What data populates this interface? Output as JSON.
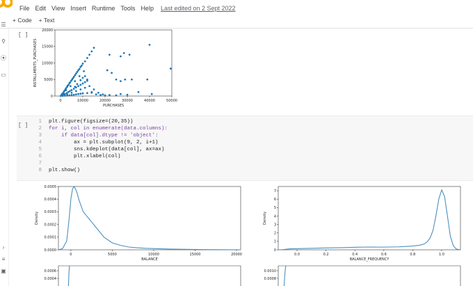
{
  "menu": {
    "items": [
      "File",
      "Edit",
      "View",
      "Insert",
      "Runtime",
      "Tools",
      "Help"
    ],
    "last_edited": "Last edited on 2 Sept 2022"
  },
  "toolbar": {
    "add_code": "+ Code",
    "add_text": "+ Text"
  },
  "cells": {
    "cell1": {
      "run_bracket": "[ ]"
    },
    "cell2": {
      "run_bracket": "[ ]",
      "code_lines": [
        {
          "n": "1",
          "t": "plt.figure(figsize=(20,35))"
        },
        {
          "n": "2",
          "t": "for i, col in enumerate(data.columns):"
        },
        {
          "n": "3",
          "t": "if data[col].dtype != 'object':"
        },
        {
          "n": "4",
          "t": "ax = plt.subplot(9, 2, i+1)"
        },
        {
          "n": "5",
          "t": "sns.kdeplot(data[col], ax=ax)"
        },
        {
          "n": "6",
          "t": "plt.xlabel(col)"
        },
        {
          "n": "7",
          "t": ""
        },
        {
          "n": "8",
          "t": "plt.show()"
        }
      ]
    }
  },
  "chart_data": [
    {
      "type": "scatter",
      "xlabel": "PURCHASES",
      "ylabel": "INSTALLMENTS_PURCHASES",
      "xlim": [
        -2500,
        50000
      ],
      "ylim": [
        0,
        20000
      ],
      "xticks": [
        "0",
        "10000",
        "20000",
        "30000",
        "40000",
        "50000"
      ],
      "yticks": [
        "0",
        "5000",
        "10000",
        "15000",
        "20000"
      ],
      "color": "#1f77b4",
      "points": [
        [
          200,
          100
        ],
        [
          500,
          400
        ],
        [
          800,
          700
        ],
        [
          1200,
          900
        ],
        [
          1500,
          1300
        ],
        [
          1800,
          1600
        ],
        [
          2200,
          2000
        ],
        [
          2500,
          2400
        ],
        [
          3000,
          2800
        ],
        [
          3200,
          3100
        ],
        [
          3600,
          3400
        ],
        [
          4000,
          3900
        ],
        [
          4300,
          4100
        ],
        [
          4800,
          4600
        ],
        [
          5200,
          5000
        ],
        [
          5600,
          5400
        ],
        [
          6000,
          5800
        ],
        [
          6500,
          6300
        ],
        [
          7000,
          6800
        ],
        [
          7500,
          7300
        ],
        [
          8000,
          7800
        ],
        [
          8500,
          8200
        ],
        [
          9000,
          8800
        ],
        [
          9500,
          9200
        ],
        [
          10000,
          9800
        ],
        [
          11000,
          10500
        ],
        [
          12000,
          11500
        ],
        [
          13000,
          12500
        ],
        [
          14000,
          13500
        ],
        [
          15000,
          14600
        ],
        [
          600,
          200
        ],
        [
          1000,
          300
        ],
        [
          1400,
          500
        ],
        [
          2000,
          600
        ],
        [
          2800,
          900
        ],
        [
          3500,
          1200
        ],
        [
          4200,
          1500
        ],
        [
          5000,
          1800
        ],
        [
          6000,
          2200
        ],
        [
          7000,
          2600
        ],
        [
          8000,
          3000
        ],
        [
          9000,
          3400
        ],
        [
          10000,
          3800
        ],
        [
          11000,
          4200
        ],
        [
          12000,
          4600
        ],
        [
          1000,
          50
        ],
        [
          2000,
          100
        ],
        [
          3000,
          150
        ],
        [
          4000,
          200
        ],
        [
          5000,
          300
        ],
        [
          6000,
          400
        ],
        [
          7000,
          500
        ],
        [
          8000,
          600
        ],
        [
          9000,
          700
        ],
        [
          10000,
          800
        ],
        [
          12000,
          900
        ],
        [
          14000,
          1000
        ],
        [
          16000,
          500
        ],
        [
          18000,
          300
        ],
        [
          20000,
          200
        ],
        [
          2500,
          1800
        ],
        [
          4500,
          3000
        ],
        [
          6500,
          4500
        ],
        [
          8500,
          6000
        ],
        [
          10500,
          7500
        ],
        [
          3000,
          500
        ],
        [
          5000,
          1000
        ],
        [
          7000,
          1500
        ],
        [
          9000,
          2000
        ],
        [
          11000,
          2500
        ],
        [
          13000,
          3000
        ],
        [
          15000,
          2000
        ],
        [
          17000,
          1000
        ],
        [
          19000,
          500
        ],
        [
          22000,
          300
        ],
        [
          25000,
          200
        ],
        [
          27000,
          600
        ],
        [
          30000,
          400
        ],
        [
          22000,
          12500
        ],
        [
          27000,
          12000
        ],
        [
          28500,
          13000
        ],
        [
          31000,
          12500
        ],
        [
          21000,
          7800
        ],
        [
          23000,
          7000
        ],
        [
          25000,
          5000
        ],
        [
          27000,
          4500
        ],
        [
          29000,
          5000
        ],
        [
          32000,
          5000
        ],
        [
          35000,
          1200
        ],
        [
          39000,
          5000
        ],
        [
          40000,
          15500
        ],
        [
          41000,
          600
        ],
        [
          49500,
          8300
        ],
        [
          14000,
          1200
        ],
        [
          12000,
          5000
        ],
        [
          11000,
          6000
        ],
        [
          10000,
          5500
        ],
        [
          9000,
          4800
        ],
        [
          7500,
          3600
        ],
        [
          6500,
          2800
        ]
      ]
    },
    {
      "type": "line",
      "xlabel": "BALANCE",
      "ylabel": "Density",
      "xlim": [
        -1500,
        20500
      ],
      "ylim": [
        0,
        0.0005
      ],
      "xticks": [
        "0",
        "5000",
        "10000",
        "15000",
        "20000"
      ],
      "yticks": [
        "0.0000",
        "0.0001",
        "0.0002",
        "0.0003",
        "0.0004",
        "0.0005"
      ],
      "color": "#4c8fbd",
      "x": [
        -1500,
        -1000,
        -500,
        -200,
        0,
        200,
        400,
        700,
        1000,
        1500,
        2000,
        2500,
        3000,
        3500,
        4000,
        5000,
        6000,
        7000,
        8000,
        9000,
        10000,
        11000,
        12000,
        14000,
        16000,
        18000,
        19000,
        20000,
        20500
      ],
      "y": [
        0.0,
        1e-05,
        7e-05,
        0.00025,
        0.0004,
        0.00048,
        0.0005,
        0.00046,
        0.00039,
        0.0003,
        0.00026,
        0.00022,
        0.00018,
        0.00014,
        0.0001,
        5.5e-05,
        3.5e-05,
        2.2e-05,
        1.6e-05,
        1.2e-05,
        1e-05,
        8e-06,
        6e-06,
        4e-06,
        2e-06,
        1e-06,
        6e-07,
        3e-07,
        0.0
      ]
    },
    {
      "type": "line",
      "xlabel": "BALANCE_FREQUENCY",
      "ylabel": "Density",
      "xlim": [
        -0.13,
        1.13
      ],
      "ylim": [
        0,
        7.5
      ],
      "xticks": [
        "0.0",
        "0.2",
        "0.4",
        "0.6",
        "0.8",
        "1.0"
      ],
      "yticks": [
        "0",
        "1",
        "2",
        "3",
        "4",
        "5",
        "6",
        "7"
      ],
      "color": "#4c8fbd",
      "x": [
        -0.13,
        -0.1,
        -0.05,
        0.0,
        0.1,
        0.2,
        0.3,
        0.4,
        0.5,
        0.6,
        0.7,
        0.75,
        0.8,
        0.85,
        0.88,
        0.9,
        0.92,
        0.94,
        0.96,
        0.98,
        1.0,
        1.02,
        1.04,
        1.06,
        1.08,
        1.1,
        1.13
      ],
      "y": [
        0.0,
        0.02,
        0.12,
        0.14,
        0.18,
        0.22,
        0.25,
        0.3,
        0.33,
        0.32,
        0.35,
        0.4,
        0.45,
        0.55,
        0.7,
        0.95,
        1.4,
        2.3,
        4.0,
        6.0,
        7.1,
        6.3,
        4.0,
        1.6,
        0.5,
        0.1,
        0.0
      ]
    },
    {
      "type": "line",
      "ylabel": "",
      "xlabel": "",
      "yticks": [
        "0.0006",
        "0.0004"
      ],
      "color": "#4c8fbd"
    },
    {
      "type": "line",
      "ylabel": "",
      "xlabel": "",
      "yticks": [
        "0.0010",
        "0.0008"
      ],
      "color": "#4c8fbd"
    }
  ]
}
